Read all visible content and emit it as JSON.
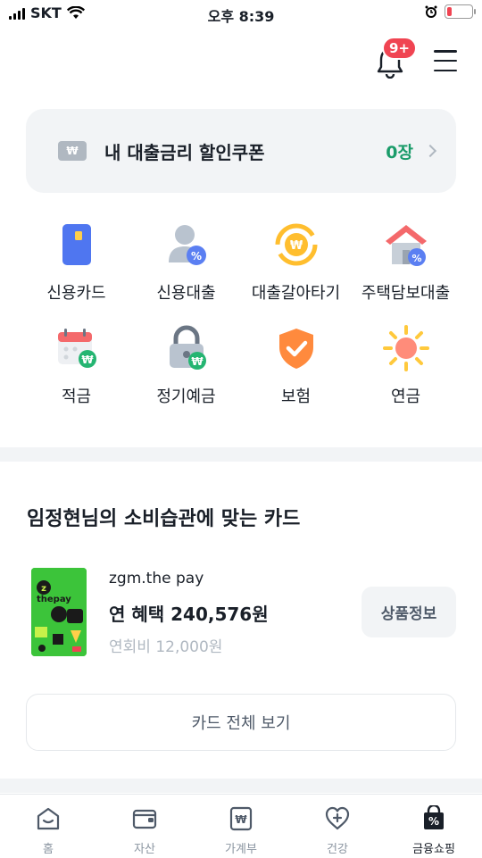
{
  "status_bar": {
    "carrier": "SKT",
    "time": "오후 8:39"
  },
  "header": {
    "notification_badge": "9+"
  },
  "coupon": {
    "title": "내 대출금리 할인쿠폰",
    "count": "0장",
    "icon_text": "₩"
  },
  "menu_items": [
    {
      "label": "신용카드",
      "icon": "credit-card-icon"
    },
    {
      "label": "신용대출",
      "icon": "credit-loan-icon"
    },
    {
      "label": "대출갈아타기",
      "icon": "loan-refinance-icon"
    },
    {
      "label": "주택담보대출",
      "icon": "mortgage-icon"
    },
    {
      "label": "적금",
      "icon": "savings-icon"
    },
    {
      "label": "정기예금",
      "icon": "deposit-icon"
    },
    {
      "label": "보험",
      "icon": "insurance-icon"
    },
    {
      "label": "연금",
      "icon": "pension-icon"
    }
  ],
  "recommendation": {
    "title": "임정현님의 소비습관에 맞는 카드",
    "card_name": "zgm.the pay",
    "benefit": "연 혜택 240,576원",
    "annual_fee": "연회비 12,000원",
    "info_button": "상품정보",
    "view_all_button": "카드 전체 보기"
  },
  "tabs": [
    {
      "label": "홈",
      "icon": "home-icon"
    },
    {
      "label": "자산",
      "icon": "wallet-icon"
    },
    {
      "label": "가계부",
      "icon": "ledger-icon"
    },
    {
      "label": "건강",
      "icon": "health-icon"
    },
    {
      "label": "금융쇼핑",
      "icon": "finance-shopping-icon",
      "active": true
    }
  ],
  "colors": {
    "accent_green": "#1b9c6a",
    "badge_red": "#f04452",
    "background_gray": "#f2f4f6"
  }
}
